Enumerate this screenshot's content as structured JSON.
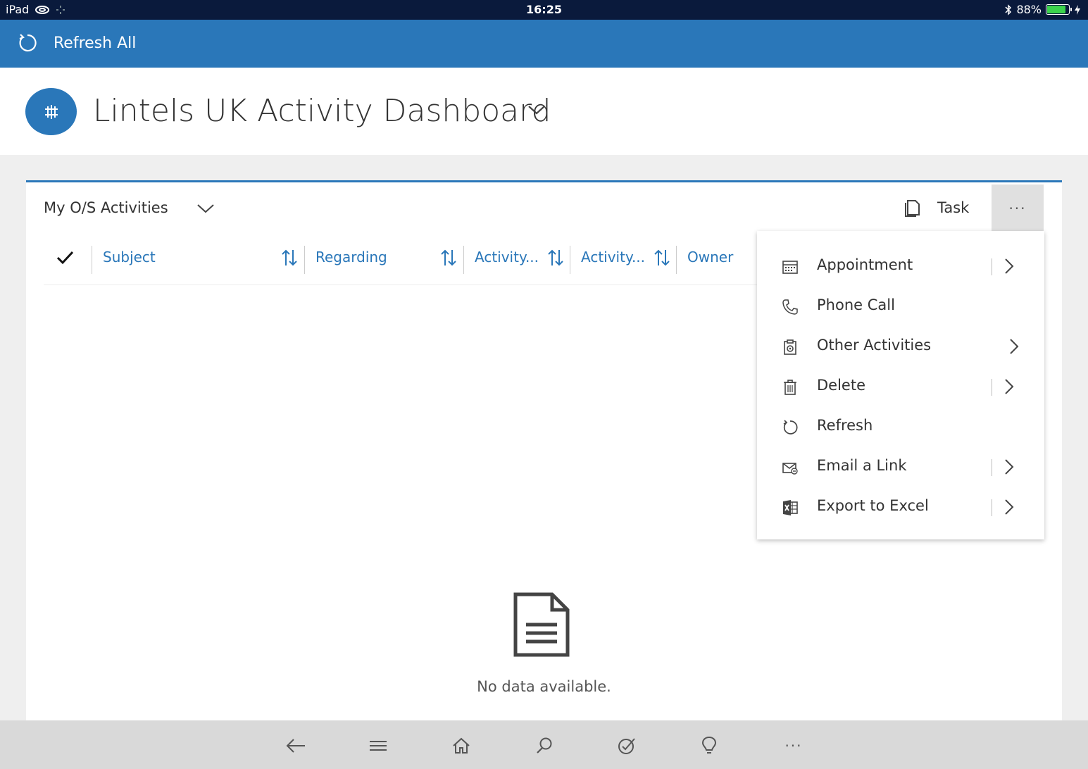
{
  "status_bar": {
    "device": "iPad",
    "time": "16:25",
    "battery": "88%",
    "battery_level": 0.88
  },
  "command_bar": {
    "refresh_all_label": "Refresh All"
  },
  "header": {
    "title": "Lintels UK Activity Dashboard"
  },
  "panel": {
    "title": "My O/S Activities",
    "task_label": "Task",
    "more_label": "···",
    "columns": [
      "Subject",
      "Regarding",
      "Activity...",
      "Activity...",
      "Owner"
    ],
    "empty_message": "No data available."
  },
  "menu": {
    "items": [
      {
        "label": "Appointment",
        "icon": "calendar-icon",
        "has_split": true
      },
      {
        "label": "Phone Call",
        "icon": "phone-icon",
        "has_split": false
      },
      {
        "label": "Other Activities",
        "icon": "clipboard-icon",
        "has_split": false
      },
      {
        "label": "Delete",
        "icon": "trash-icon",
        "has_split": true
      },
      {
        "label": "Refresh",
        "icon": "refresh-icon",
        "has_split": false
      },
      {
        "label": "Email a Link",
        "icon": "email-link-icon",
        "has_split": true
      },
      {
        "label": "Export to Excel",
        "icon": "excel-icon",
        "has_split": true
      }
    ]
  },
  "bottom_nav": {
    "more_label": "···"
  },
  "colors": {
    "status_bar": "#0a1a3c",
    "accent": "#2a77b9",
    "battery": "#3bd34c"
  }
}
